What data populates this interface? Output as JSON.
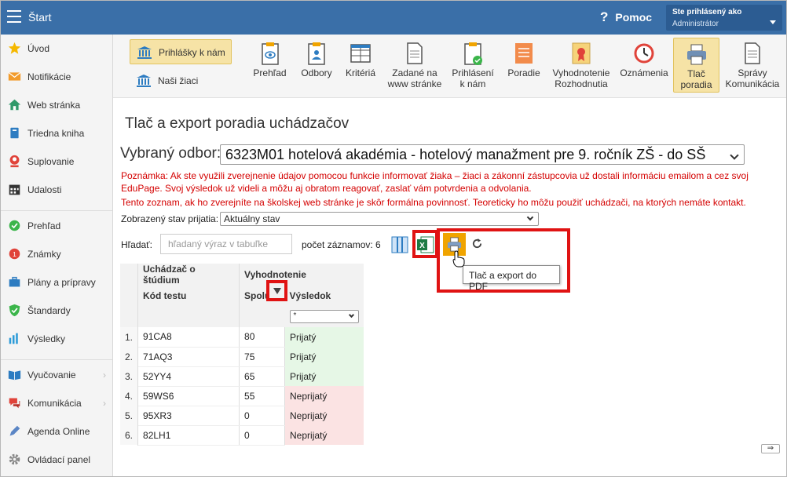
{
  "topbar": {
    "title": "Štart",
    "help_label": "Pomoc",
    "user_line1": "Ste prihlásený ako",
    "user_line2": "Administrátor"
  },
  "sidebar": {
    "items": [
      {
        "label": "Úvod",
        "icon": "star-icon"
      },
      {
        "label": "Notifikácie",
        "icon": "envelope-icon"
      },
      {
        "label": "Web stránka",
        "icon": "home-icon"
      },
      {
        "label": "Triedna kniha",
        "icon": "book-icon"
      },
      {
        "label": "Suplovanie",
        "icon": "person-icon"
      },
      {
        "label": "Udalosti",
        "icon": "calendar-icon"
      },
      {
        "label": "Prehľad",
        "icon": "check-circle-icon"
      },
      {
        "label": "Známky",
        "icon": "grade-icon"
      },
      {
        "label": "Plány a prípravy",
        "icon": "briefcase-icon"
      },
      {
        "label": "Štandardy",
        "icon": "shield-check-icon"
      },
      {
        "label": "Výsledky",
        "icon": "bar-chart-icon"
      },
      {
        "label": "Vyučovanie",
        "icon": "book-open-icon"
      },
      {
        "label": "Komunikácia",
        "icon": "chat-icon"
      },
      {
        "label": "Agenda Online",
        "icon": "pen-icon"
      },
      {
        "label": "Ovládací panel",
        "icon": "gear-icon"
      }
    ]
  },
  "toolbar": {
    "primary": "Prihlášky k nám",
    "secondary": "Naši žiaci",
    "tools": [
      {
        "label": "Prehľad"
      },
      {
        "label": "Odbory"
      },
      {
        "label": "Kritériá"
      },
      {
        "label": "Zadané na www stránke"
      },
      {
        "label": "Prihlásení k nám"
      },
      {
        "label": "Poradie"
      },
      {
        "label": "Vyhodnotenie Rozhodnutia"
      },
      {
        "label": "Oznámenia"
      },
      {
        "label": "Tlač poradia"
      },
      {
        "label": "Správy Komunikácia"
      }
    ]
  },
  "page": {
    "title": "Tlač a export poradia uchádzačov",
    "odbor_label": "Vybraný odbor:",
    "odbor_value": "6323M01 hotelová akadémia - hotelový manažment pre 9. ročník ZŠ - do SŠ",
    "note1_line1": "Poznámka: Ak ste využili zverejnenie údajov pomocou funkcie informovať žiaka – žiaci a zákonní zástupcovia už dostali informáciu emailom a cez svoj",
    "note1_line2": "EduPage. Svoj výsledok už videli a môžu aj obratom reagovať, zaslať vám potvrdenia a odvolania.",
    "note2": "Tento zoznam, ak ho zverejníte na školskej web stránke je skôr formálna povinnosť. Teoreticky ho môžu použiť uchádzači, na ktorých nemáte kontakt.",
    "stav_label": "Zobrazený stav prijatia:",
    "stav_value": "Aktuálny stav",
    "search_label": "Hľadať:",
    "search_placeholder": "hľadaný výraz v tabuľke",
    "count_label": "počet záznamov: 6",
    "tooltip": "Tlač a export do PDF"
  },
  "table": {
    "group1": "Uchádzač o štúdium",
    "group2": "Vyhodnotenie",
    "col_code": "Kód testu",
    "col_score": "Spolu",
    "col_result": "Výsledok",
    "filter_value": "*",
    "rows": [
      {
        "n": "1.",
        "code": "91CA8",
        "score": "80",
        "result": "Prijatý",
        "status": "pos"
      },
      {
        "n": "2.",
        "code": "71AQ3",
        "score": "75",
        "result": "Prijatý",
        "status": "pos"
      },
      {
        "n": "3.",
        "code": "52YY4",
        "score": "65",
        "result": "Prijatý",
        "status": "pos"
      },
      {
        "n": "4.",
        "code": "59WS6",
        "score": "55",
        "result": "Neprijatý",
        "status": "neg"
      },
      {
        "n": "5.",
        "code": "95XR3",
        "score": "0",
        "result": "Neprijatý",
        "status": "neg"
      },
      {
        "n": "6.",
        "code": "82LH1",
        "score": "0",
        "result": "Neprijatý",
        "status": "neg"
      }
    ]
  },
  "colors": {
    "topbar": "#3a6fa8",
    "active": "#f6e3a6",
    "highlight": "#e01313",
    "note": "#d40000"
  }
}
